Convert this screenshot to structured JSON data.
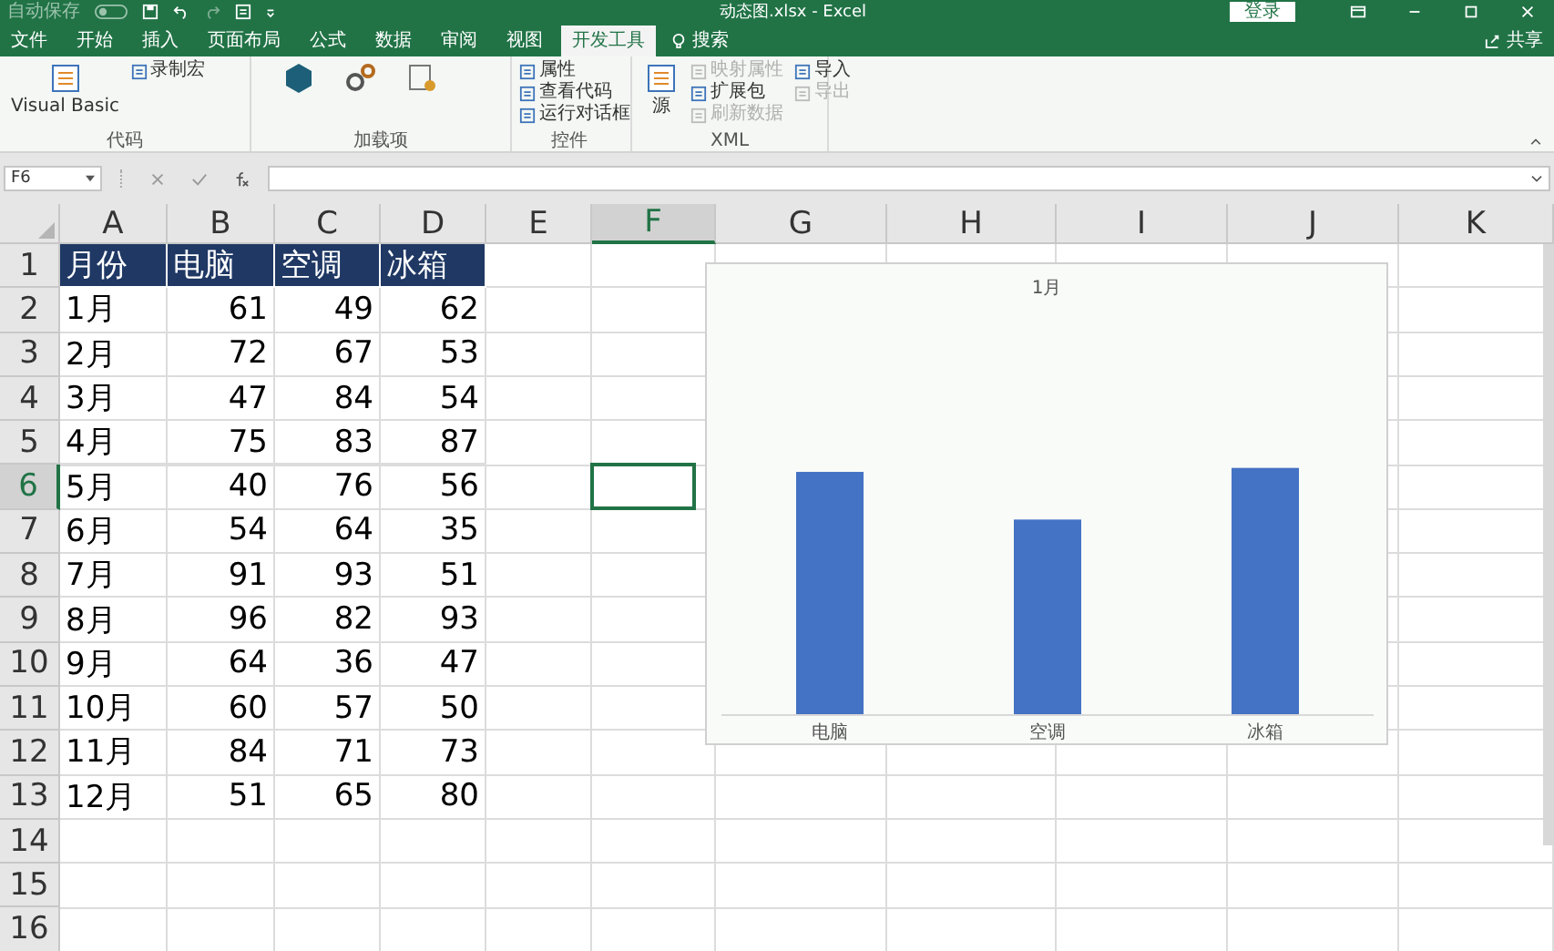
{
  "title_bar": {
    "autosave": "自动保存",
    "title": "动态图.xlsx - Excel",
    "sign_in": "登录"
  },
  "tabs": [
    {
      "label": "文件",
      "selected": false
    },
    {
      "label": "开始",
      "selected": false
    },
    {
      "label": "插入",
      "selected": false
    },
    {
      "label": "页面布局",
      "selected": false
    },
    {
      "label": "公式",
      "selected": false
    },
    {
      "label": "数据",
      "selected": false
    },
    {
      "label": "审阅",
      "selected": false
    },
    {
      "label": "视图",
      "selected": false
    },
    {
      "label": "开发工具",
      "selected": true
    }
  ],
  "search": "搜索",
  "share": "共享",
  "ribbon": {
    "groups": [
      {
        "label": "代码",
        "kind": "code",
        "items": [
          {
            "label": "Visual Basic",
            "kind": "large",
            "disabled": false
          },
          {
            "label": "录制宏",
            "kind": "small",
            "disabled": false
          }
        ]
      },
      {
        "label": "加载项",
        "kind": "addins"
      },
      {
        "label": "控件",
        "kind": "controls",
        "items": [
          {
            "label": "属性",
            "kind": "small",
            "disabled": false
          },
          {
            "label": "查看代码",
            "kind": "small",
            "disabled": false
          },
          {
            "label": "运行对话框",
            "kind": "small",
            "disabled": false
          }
        ]
      },
      {
        "label": "XML",
        "kind": "xml",
        "items": [
          {
            "label": "源",
            "kind": "large",
            "disabled": false
          },
          {
            "label": "映射属性",
            "kind": "small",
            "disabled": true
          },
          {
            "label": "扩展包",
            "kind": "small",
            "disabled": false
          },
          {
            "label": "刷新数据",
            "kind": "small",
            "disabled": true
          },
          {
            "label": "导入",
            "kind": "small",
            "disabled": false
          },
          {
            "label": "导出",
            "kind": "small",
            "disabled": true
          }
        ]
      }
    ]
  },
  "formula_bar": {
    "name_box": "F6"
  },
  "columns": [
    {
      "label": "A",
      "selected": false
    },
    {
      "label": "B",
      "selected": false
    },
    {
      "label": "C",
      "selected": false
    },
    {
      "label": "D",
      "selected": false
    },
    {
      "label": "E",
      "selected": false
    },
    {
      "label": "F",
      "selected": true
    },
    {
      "label": "G",
      "selected": false
    },
    {
      "label": "H",
      "selected": false
    },
    {
      "label": "I",
      "selected": false
    },
    {
      "label": "J",
      "selected": false
    },
    {
      "label": "K",
      "selected": false
    }
  ],
  "rows": [
    {
      "label": "1",
      "selected": false
    },
    {
      "label": "2",
      "selected": false
    },
    {
      "label": "3",
      "selected": false
    },
    {
      "label": "4",
      "selected": false
    },
    {
      "label": "5",
      "selected": false
    },
    {
      "label": "6",
      "selected": true
    },
    {
      "label": "7",
      "selected": false
    },
    {
      "label": "8",
      "selected": false
    },
    {
      "label": "9",
      "selected": false
    },
    {
      "label": "10",
      "selected": false
    },
    {
      "label": "11",
      "selected": false
    },
    {
      "label": "12",
      "selected": false
    },
    {
      "label": "13",
      "selected": false
    },
    {
      "label": "14",
      "selected": false
    },
    {
      "label": "15",
      "selected": false
    },
    {
      "label": "16",
      "selected": false
    }
  ],
  "table": {
    "header": [
      "月份",
      "电脑",
      "空调",
      "冰箱"
    ],
    "rows": [
      {
        "month": "1月",
        "values": [
          "61",
          "49",
          "62"
        ]
      },
      {
        "month": "2月",
        "values": [
          "72",
          "67",
          "53"
        ]
      },
      {
        "month": "3月",
        "values": [
          "47",
          "84",
          "54"
        ]
      },
      {
        "month": "4月",
        "values": [
          "75",
          "83",
          "87"
        ]
      },
      {
        "month": "5月",
        "values": [
          "40",
          "76",
          "56"
        ]
      },
      {
        "month": "6月",
        "values": [
          "54",
          "64",
          "35"
        ]
      },
      {
        "month": "7月",
        "values": [
          "91",
          "93",
          "51"
        ]
      },
      {
        "month": "8月",
        "values": [
          "96",
          "82",
          "93"
        ]
      },
      {
        "month": "9月",
        "values": [
          "64",
          "36",
          "47"
        ]
      },
      {
        "month": "10月",
        "values": [
          "60",
          "57",
          "50"
        ]
      },
      {
        "month": "11月",
        "values": [
          "84",
          "71",
          "73"
        ]
      },
      {
        "month": "12月",
        "values": [
          "51",
          "65",
          "80"
        ]
      }
    ]
  },
  "chart": {
    "title": "1月",
    "categories": [
      "电脑",
      "空调",
      "冰箱"
    ]
  }
}
